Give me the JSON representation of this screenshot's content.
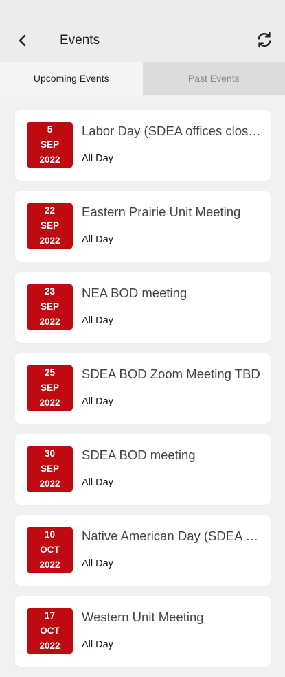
{
  "header": {
    "title": "Events",
    "back_icon": "chevron-left-icon",
    "refresh_icon": "refresh-icon"
  },
  "tabs": [
    {
      "label": "Upcoming Events",
      "active": true
    },
    {
      "label": "Past Events",
      "active": false
    }
  ],
  "colors": {
    "badge": "#bf0a12",
    "card": "#ffffff",
    "background": "#f1f1f1"
  },
  "events": [
    {
      "day": "5",
      "month": "SEP",
      "year": "2022",
      "title": "Labor Day (SDEA offices closed)",
      "time": "All Day"
    },
    {
      "day": "22",
      "month": "SEP",
      "year": "2022",
      "title": "Eastern Prairie Unit Meeting",
      "time": "All Day"
    },
    {
      "day": "23",
      "month": "SEP",
      "year": "2022",
      "title": "NEA BOD meeting",
      "time": "All Day"
    },
    {
      "day": "25",
      "month": "SEP",
      "year": "2022",
      "title": "SDEA BOD Zoom Meeting TBD",
      "time": "All Day"
    },
    {
      "day": "30",
      "month": "SEP",
      "year": "2022",
      "title": "SDEA BOD meeting",
      "time": "All Day"
    },
    {
      "day": "10",
      "month": "OCT",
      "year": "2022",
      "title": "Native American Day (SDEA offices closed)",
      "time": "All Day"
    },
    {
      "day": "17",
      "month": "OCT",
      "year": "2022",
      "title": "Western Unit Meeting",
      "time": "All Day"
    }
  ]
}
